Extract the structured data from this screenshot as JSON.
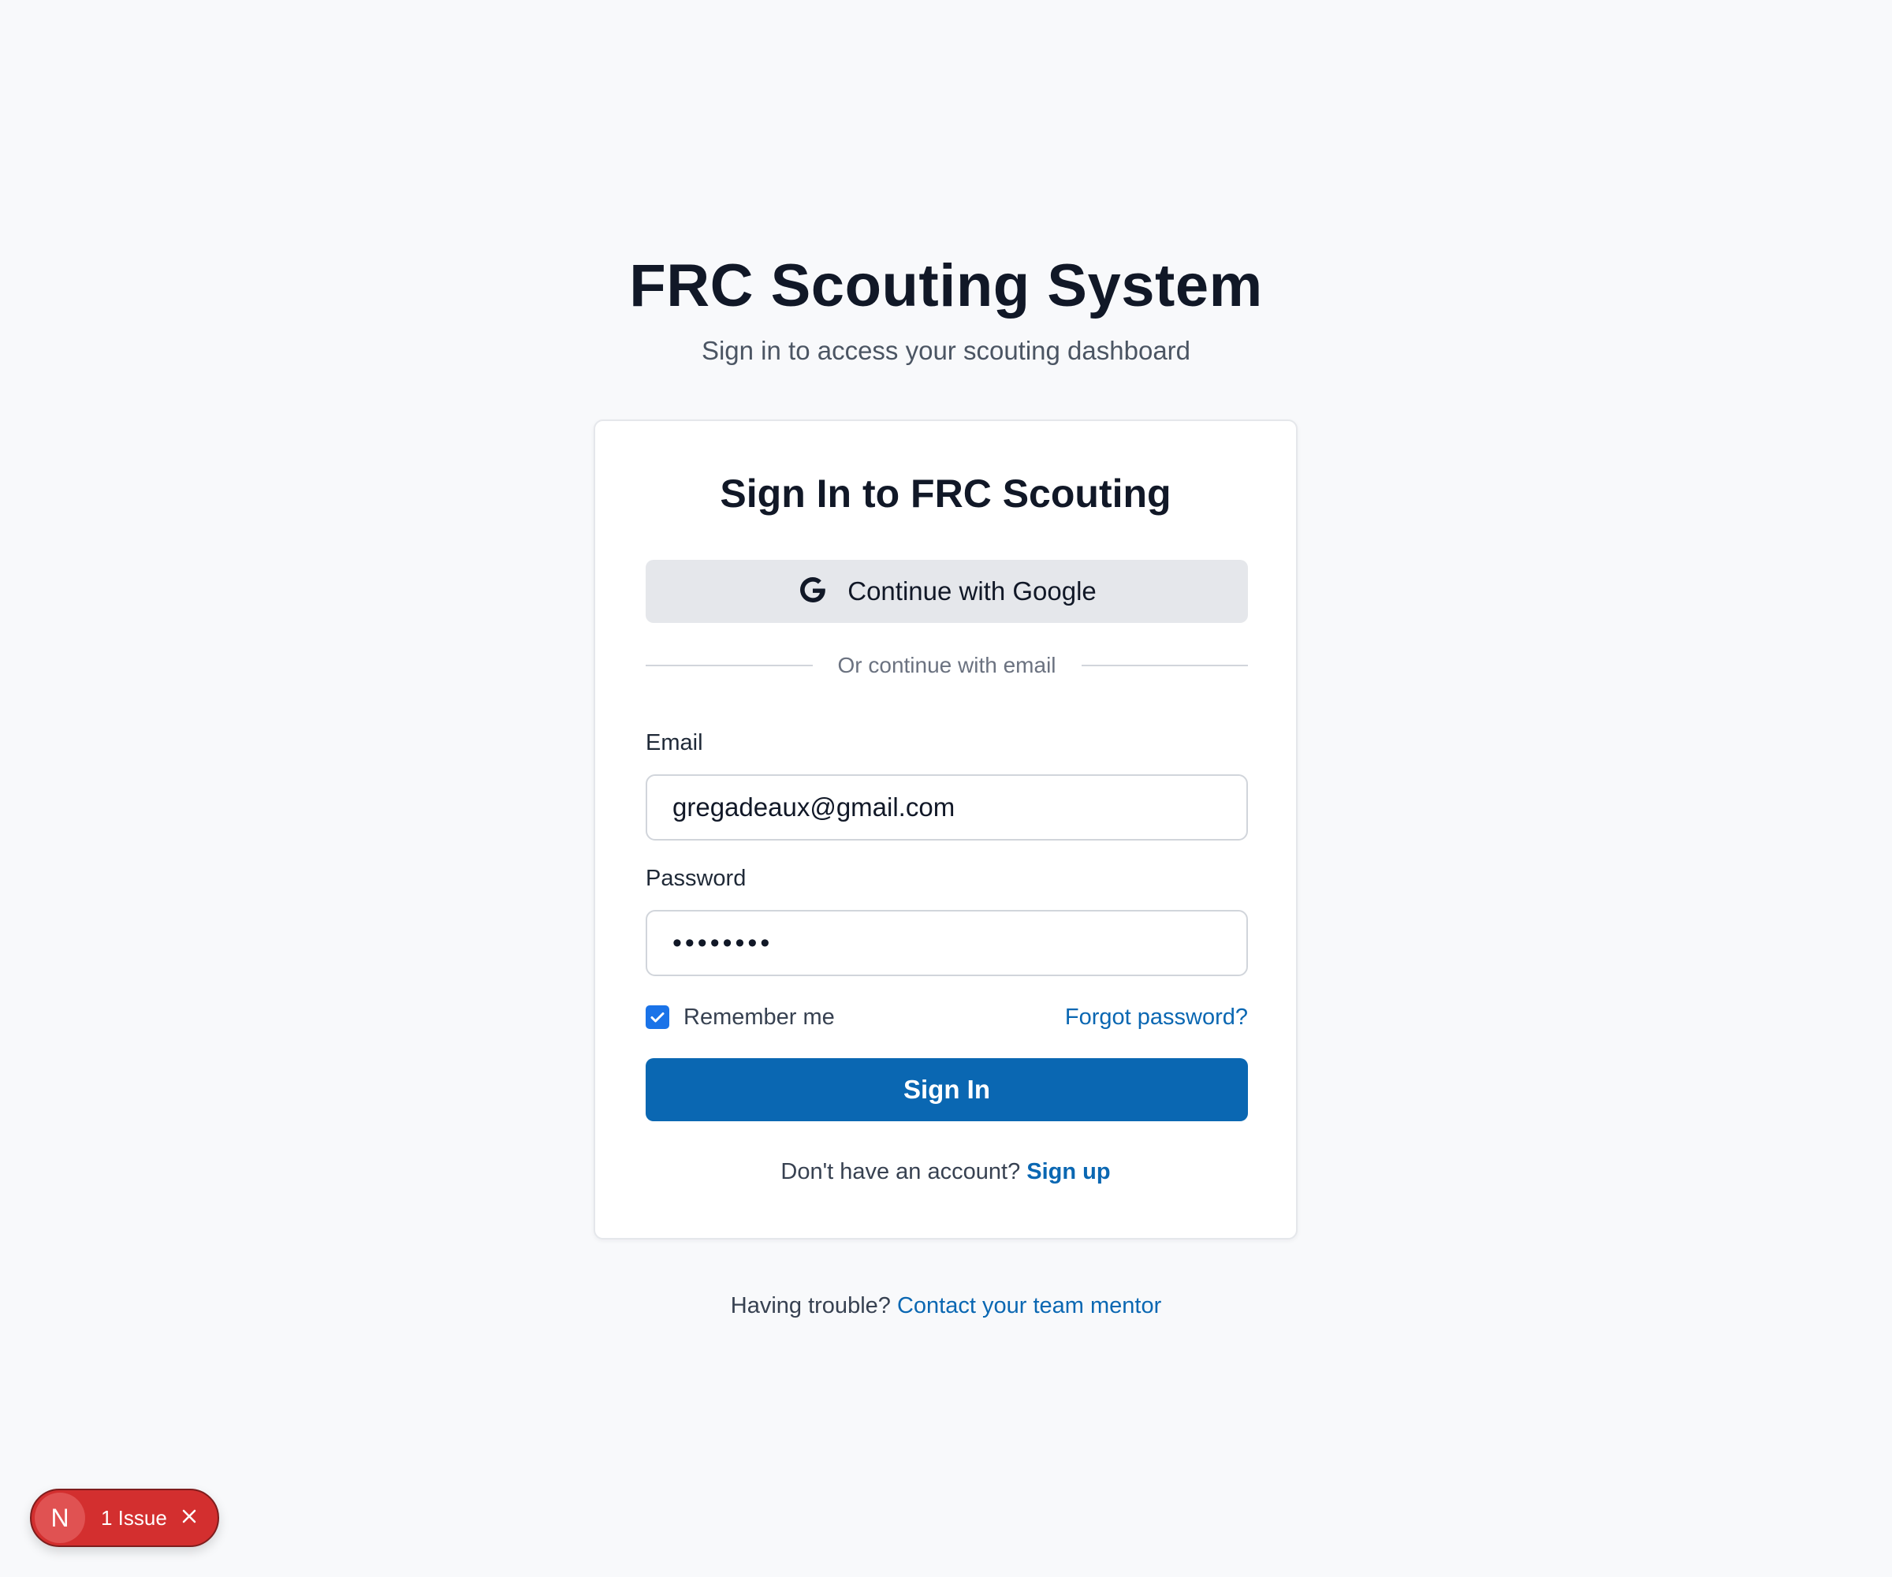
{
  "header": {
    "title": "FRC Scouting System",
    "subtitle": "Sign in to access your scouting dashboard"
  },
  "card": {
    "title": "Sign In to FRC Scouting",
    "google_button": {
      "label": "Continue with Google",
      "icon": "google-icon"
    },
    "divider_text": "Or continue with email",
    "email": {
      "label": "Email",
      "value": "gregadeaux@gmail.com"
    },
    "password": {
      "label": "Password",
      "masked_value": "••••••••"
    },
    "remember_me": {
      "label": "Remember me",
      "checked": true
    },
    "forgot_password": "Forgot password?",
    "sign_in_button": "Sign In",
    "signup_prompt": "Don't have an account?",
    "signup_link": "Sign up"
  },
  "footer": {
    "prompt": "Having trouble?",
    "link": "Contact your team mentor"
  },
  "issue_badge": {
    "letter": "N",
    "label": "1 Issue",
    "close_icon": "close-icon"
  },
  "colors": {
    "background": "#f8f9fb",
    "primary": "#0a67b2",
    "google_button_bg": "#e5e7eb",
    "checkbox": "#1a73e8",
    "issue_badge": "#d32f2f"
  }
}
